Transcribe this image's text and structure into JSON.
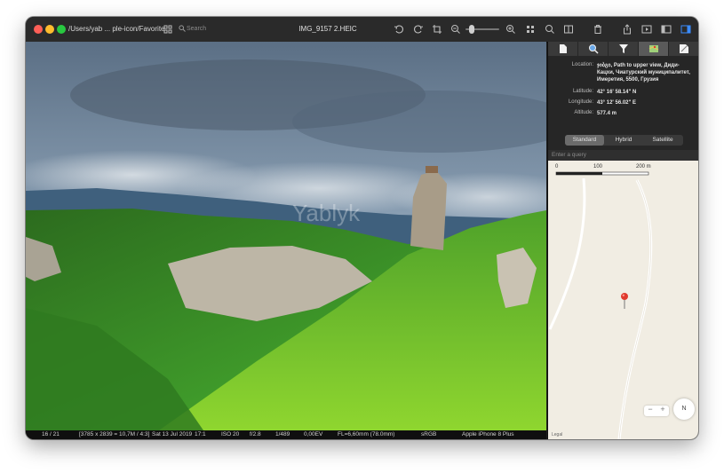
{
  "window": {
    "path": "/Users/yab ... ple-icon/Favorite",
    "title": "IMG_9157 2.HEIC",
    "search_placeholder": "Search"
  },
  "photo": {
    "watermark": "Yablyk",
    "description_colors": {
      "sky": "#6f8aa6",
      "forest": "#3f9a2a",
      "cliff": "#c9c2b2"
    }
  },
  "status": {
    "index": "16 / 21",
    "dimensions": "[3785 x 2839 = 10,7M / 4:3]",
    "date": "Sat 13 Jul 2019",
    "time": "17:1",
    "iso": "ISO 20",
    "aperture": "f/2.8",
    "shutter": "1/489",
    "exposure": "0,00EV",
    "focal": "FL=6,60mm (78.0mm)",
    "colorspace": "sRGB",
    "camera": "Apple iPhone 8 Plus"
  },
  "panel": {
    "tabs": [
      {
        "icon": "document-icon"
      },
      {
        "icon": "magnifier-icon"
      },
      {
        "icon": "filter-icon"
      },
      {
        "icon": "map-icon",
        "active": true
      },
      {
        "icon": "note-icon"
      }
    ],
    "location_label": "Location:",
    "location_value": "ჯიბგი, Path to upper view, Диди-Кацхи, Чиатурский муниципалитет, Имеретия, 5500, Грузия",
    "latitude_label": "Latitude:",
    "latitude_value": "42° 16' 58.14\" N",
    "longitude_label": "Longitude:",
    "longitude_value": "43° 12' 56.02\" E",
    "altitude_label": "Altitude:",
    "altitude_value": "577.4 m",
    "map_modes": [
      "Standard",
      "Hybrid",
      "Satellite"
    ],
    "selected_mode": "Standard",
    "query_placeholder": "Enter a query",
    "scale_labels": [
      "0",
      "100",
      "200 m"
    ],
    "legal": "Legal",
    "zoom_minus": "−",
    "zoom_plus": "+",
    "compass": "N",
    "pin_color": "#e03a2e"
  }
}
